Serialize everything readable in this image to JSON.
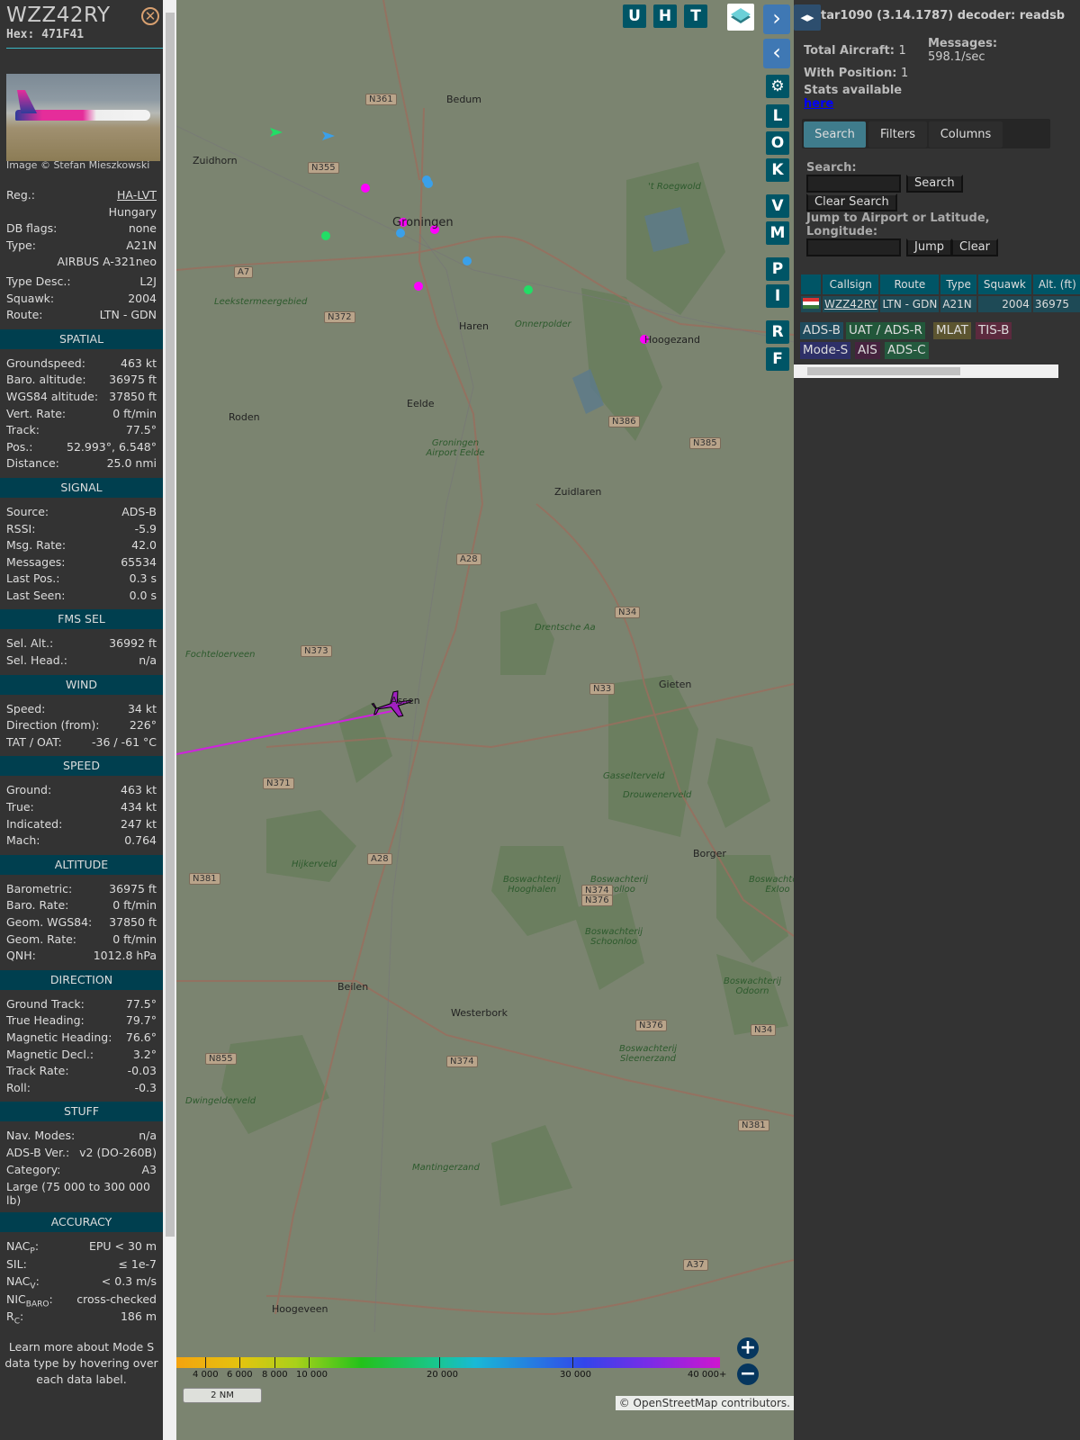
{
  "aircraft": {
    "callsign": "WZZ42RY",
    "hex_label": "Hex:",
    "hex": "471F41",
    "photo_credit": "Image © Stefan Mieszkowski"
  },
  "info": [
    [
      "Reg.:",
      "HA-LVT"
    ],
    [
      "",
      "Hungary"
    ],
    [
      "DB flags:",
      "none"
    ],
    [
      "Type:",
      "A21N"
    ],
    [
      "",
      "AIRBUS A-321neo"
    ],
    [
      "Type Desc.:",
      "L2J"
    ],
    [
      "Squawk:",
      "2004"
    ],
    [
      "Route:",
      "LTN - GDN"
    ]
  ],
  "sections": [
    {
      "title": "SPATIAL",
      "rows": [
        [
          "Groundspeed:",
          "463 kt"
        ],
        [
          "Baro. altitude:",
          "36975 ft"
        ],
        [
          "WGS84 altitude:",
          "37850 ft"
        ],
        [
          "Vert. Rate:",
          "0 ft/min"
        ],
        [
          "Track:",
          "77.5°"
        ],
        [
          "Pos.:",
          "52.993°, 6.548°"
        ],
        [
          "Distance:",
          "25.0 nmi"
        ]
      ]
    },
    {
      "title": "SIGNAL",
      "rows": [
        [
          "Source:",
          "ADS-B"
        ],
        [
          "RSSI:",
          "-5.9"
        ],
        [
          "Msg. Rate:",
          "42.0"
        ],
        [
          "Messages:",
          "65534"
        ],
        [
          "Last Pos.:",
          "0.3 s"
        ],
        [
          "Last Seen:",
          "0.0 s"
        ]
      ]
    },
    {
      "title": "FMS SEL",
      "rows": [
        [
          "Sel. Alt.:",
          "36992 ft"
        ],
        [
          "Sel. Head.:",
          "n/a"
        ]
      ]
    },
    {
      "title": "WIND",
      "rows": [
        [
          "Speed:",
          "34 kt"
        ],
        [
          "Direction (from):",
          "226°"
        ],
        [
          "TAT / OAT:",
          "-36 / -61 °C"
        ]
      ]
    },
    {
      "title": "SPEED",
      "rows": [
        [
          "Ground:",
          "463 kt"
        ],
        [
          "True:",
          "434 kt"
        ],
        [
          "Indicated:",
          "247 kt"
        ],
        [
          "Mach:",
          "0.764"
        ]
      ]
    },
    {
      "title": "ALTITUDE",
      "rows": [
        [
          "Barometric:",
          "36975 ft"
        ],
        [
          "Baro. Rate:",
          "0 ft/min"
        ],
        [
          "Geom. WGS84:",
          "37850 ft"
        ],
        [
          "Geom. Rate:",
          "0 ft/min"
        ],
        [
          "QNH:",
          "1012.8 hPa"
        ]
      ]
    },
    {
      "title": "DIRECTION",
      "rows": [
        [
          "Ground Track:",
          "77.5°"
        ],
        [
          "True Heading:",
          "79.7°"
        ],
        [
          "Magnetic Heading:",
          "76.6°"
        ],
        [
          "Magnetic Decl.:",
          "3.2°"
        ],
        [
          "Track Rate:",
          "-0.03"
        ],
        [
          "Roll:",
          "-0.3"
        ]
      ]
    },
    {
      "title": "STUFF",
      "rows": [
        [
          "Nav. Modes:",
          "n/a"
        ],
        [
          "ADS-B Ver.:",
          "v2 (DO-260B)"
        ],
        [
          "Category:",
          "A3"
        ]
      ],
      "wrap": "Large (75 000 to 300 000 lb)"
    }
  ],
  "accuracy": {
    "title": "ACCURACY",
    "nacp": "NAC",
    "nacp_sub": "P",
    "nacp_v": "EPU < 30 m",
    "sil": "SIL:",
    "sil_v": "≤ 1e-7",
    "nacv": "NAC",
    "nacv_sub": "V",
    "nacv_v": "< 0.3 m/s",
    "nic": "NIC",
    "nic_sub": "BARO",
    "nic_v": "cross-checked",
    "rc": "R",
    "rc_sub": "C",
    "rc_v": "186 m",
    "colon": ":"
  },
  "note": "Learn more about Mode S data type by hovering over each data label.",
  "map": {
    "buttons_top": [
      "U",
      "H",
      "T"
    ],
    "buttons_side": [
      "L",
      "O",
      "K",
      "V",
      "M",
      "P",
      "I",
      "R",
      "F"
    ],
    "towns": [
      "Bedum",
      "Zuidhorn",
      "Groningen",
      "Haren",
      "Hoogezand",
      "Roden",
      "Eelde",
      "Zuidlaren",
      "Assen",
      "Gieten",
      "Borger",
      "Beilen",
      "Westerbork",
      "Hoogeveen"
    ],
    "green_labels": [
      "Leekstermeergebied",
      "Onnerpolder",
      "'t Roegwold",
      "Groningen Airport Eelde",
      "Drentsche Aa",
      "Fochteloerveen",
      "Gasselterveld",
      "Drouwenerveld",
      "Hijkerveld",
      "Boswachterij Hooghalen",
      "Boswachterij Grolloo",
      "Boswachterij Schoonloo",
      "Boswachterij Exloo",
      "Boswachterij Odoorn",
      "Boswachterij Sleenerzand",
      "Dwingelderveld",
      "Mantingerzand"
    ],
    "roads": [
      "N361",
      "N355",
      "A7",
      "N372",
      "N386",
      "N385",
      "A28",
      "N373",
      "N34",
      "N33",
      "N371",
      "N381",
      "A28",
      "N374",
      "N376",
      "N376",
      "N34",
      "N855",
      "N374",
      "N381",
      "A37"
    ],
    "colorbar_ticks": [
      "4 000",
      "6 000",
      "8 000",
      "10 000",
      "20 000",
      "30 000",
      "40 000+"
    ],
    "scale": "2 NM",
    "zoom_in": "+",
    "zoom_out": "−",
    "attribution_prefix": "© ",
    "attribution_link": "OpenStreetMap",
    "attribution_suffix": " contributors."
  },
  "right": {
    "app": "tar1090",
    "version": "(3.14.1787)",
    "decoder_label": "decoder:",
    "decoder": "readsb",
    "total_label": "Total Aircraft:",
    "total": "1",
    "messages_label": "Messages:",
    "messages": "598.1/sec",
    "position_label": "With Position:",
    "position": "1",
    "stats_label": "Stats available",
    "stats_link": "here",
    "tabs": [
      "Search",
      "Filters",
      "Columns"
    ],
    "search_label": "Search:",
    "search_btn": "Search",
    "clear_search_btn": "Clear Search",
    "jump_label": "Jump to Airport or Latitude, Longitude:",
    "jump_btn": "Jump",
    "clear_btn": "Clear",
    "columns": [
      "",
      "Callsign",
      "Route",
      "Type",
      "Squawk",
      "Alt. (ft)"
    ],
    "row": {
      "callsign": "WZZ42RY",
      "route": "LTN - GDN",
      "type": "A21N",
      "squawk": "2004",
      "alt": "36975"
    },
    "legend": [
      {
        "label": "ADS-B",
        "color": "#1f4b5d"
      },
      {
        "label": "UAT / ADS-R",
        "color": "#22573a"
      },
      {
        "label": "MLAT",
        "color": "#5c5530"
      },
      {
        "label": "TIS-B",
        "color": "#5c2a3e"
      },
      {
        "label": "Mode-S",
        "color": "#2e3068"
      },
      {
        "label": "AIS",
        "color": "#46233f"
      },
      {
        "label": "ADS-C",
        "color": "#245a3e"
      }
    ]
  }
}
